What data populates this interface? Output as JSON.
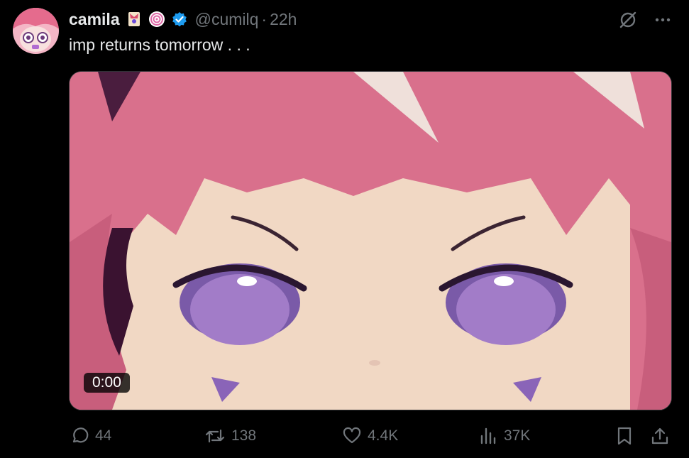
{
  "post": {
    "author_name": "camila",
    "handle": "@cumilq",
    "separator": "·",
    "time": "22h",
    "text": "imp returns tomorrow . . .",
    "video_time": "0:00"
  },
  "actions": {
    "replies": "44",
    "reposts": "138",
    "likes": "4.4K",
    "views": "37K"
  },
  "icons": {
    "verified": "verified-badge-icon",
    "grok": "grok-icon",
    "more": "more-icon",
    "reply": "reply-icon",
    "repost": "repost-icon",
    "like": "like-icon",
    "views": "views-icon",
    "bookmark": "bookmark-icon",
    "share": "share-icon"
  },
  "colors": {
    "background": "#000000",
    "text": "#e7e9ea",
    "secondary": "#71767b",
    "verified": "#1d9bf0"
  }
}
